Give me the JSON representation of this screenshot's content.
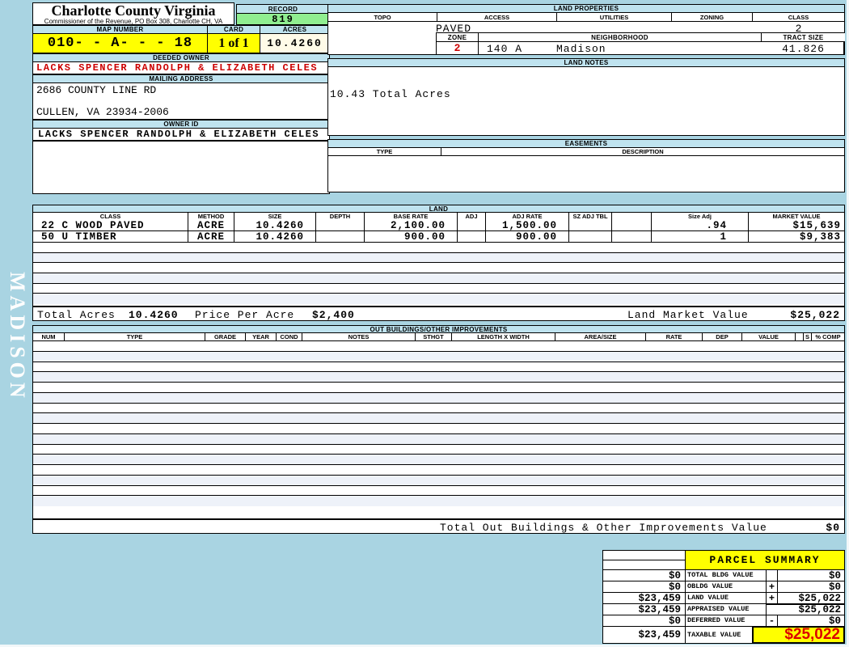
{
  "sidebar": {
    "district_label": "MADISON"
  },
  "header": {
    "title": "Charlotte County Virginia",
    "subtitle": "Commissioner of the Revenue, PO Box 308, Charlotte CH, VA",
    "record_label": "RECORD",
    "record_value": "819",
    "map_number_label": "MAP NUMBER",
    "map_number_value": "010- - A- - - 18",
    "card_label": "CARD",
    "card_value": "1 of 1",
    "acres_label": "ACRES",
    "acres_value": "10.4260",
    "deeded_owner_label": "DEEDED OWNER",
    "deeded_owner_value": "LACKS SPENCER RANDOLPH & ELIZABETH CELES",
    "mailing_address_label": "MAILING ADDRESS",
    "address_line1": "2686 COUNTY LINE RD",
    "address_line2": "CULLEN, VA 23934-2006",
    "owner_id_label": "OWNER ID",
    "owner_id_value": "LACKS SPENCER RANDOLPH & ELIZABETH CELES"
  },
  "land_properties": {
    "title": "LAND PROPERTIES",
    "topo_label": "TOPO",
    "access_label": "ACCESS",
    "utilities_label": "UTILITIES",
    "zoning_label": "ZONING",
    "class_label": "CLASS",
    "access_value": "PAVED",
    "class_value": "2",
    "zone_label": "ZONE",
    "neighborhood_label": "NEIGHBORHOOD",
    "tract_size_label": "TRACT SIZE",
    "zone_value": "2",
    "neighborhood_code": "140 A",
    "neighborhood_name": "Madison",
    "tract_size_value": "41.826"
  },
  "land_notes": {
    "title": "LAND NOTES",
    "note": "10.43 Total Acres"
  },
  "easements": {
    "title": "EASEMENTS",
    "type_label": "TYPE",
    "description_label": "DESCRIPTION"
  },
  "land": {
    "title": "LAND",
    "headers": [
      "CLASS",
      "METHOD",
      "SIZE",
      "DEPTH",
      "BASE RATE",
      "ADJ",
      "ADJ RATE",
      "SZ ADJ TBL",
      "",
      "Size Adj",
      "MARKET VALUE"
    ],
    "rows": [
      {
        "cells": [
          "22 C WOOD PAVED",
          "ACRE",
          "10.4260",
          "",
          "2,100.00",
          "",
          "1,500.00",
          "",
          "",
          ".94",
          "$15,639"
        ]
      },
      {
        "cells": [
          "50 U TIMBER",
          "ACRE",
          "10.4260",
          "",
          "900.00",
          "",
          "900.00",
          "",
          "",
          "1",
          "$9,383"
        ]
      }
    ],
    "total_acres_label": "Total Acres",
    "total_acres_value": "10.4260",
    "price_per_acre_label": "Price Per Acre",
    "price_per_acre_value": "$2,400",
    "market_value_label": "Land Market Value",
    "market_value_total": "$25,022"
  },
  "out_buildings": {
    "title": "OUT BUILDINGS/OTHER IMPROVEMENTS",
    "headers": [
      "NUM",
      "TYPE",
      "GRADE",
      "YEAR",
      "COND",
      "NOTES",
      "STHGT",
      "LENGTH X WIDTH",
      "AREA/SIZE",
      "RATE",
      "DEP",
      "VALUE",
      "",
      "S",
      "% COMP"
    ],
    "total_label": "Total Out Buildings & Other Improvements Value",
    "total_value": "$0"
  },
  "parcel_summary": {
    "title": "PARCEL SUMMARY",
    "rows": [
      {
        "prior": "$0",
        "label": "TOTAL BLDG VALUE",
        "op": "",
        "value": "$0"
      },
      {
        "prior": "$0",
        "label": "OBLDG VALUE",
        "op": "+",
        "value": "$0"
      },
      {
        "prior": "$23,459",
        "label": "LAND VALUE",
        "op": "+",
        "value": "$25,022"
      },
      {
        "prior": "$23,459",
        "label": "APPRAISED VALUE",
        "op": "",
        "value": "$25,022"
      },
      {
        "prior": "$0",
        "label": "DEFERRED VALUE",
        "op": "-",
        "value": "$0"
      },
      {
        "prior": "$23,459",
        "label": "TAXABLE VALUE",
        "op": "",
        "value": "$25,022"
      }
    ]
  },
  "colors": {
    "page_background": "#a9d4e2",
    "section_band_blue": "#bfe3ef",
    "record_green": "#90ee90",
    "highlight_yellow": "#ffff00",
    "acres_cream": "#fffbe8",
    "alert_red": "#cc0000"
  }
}
